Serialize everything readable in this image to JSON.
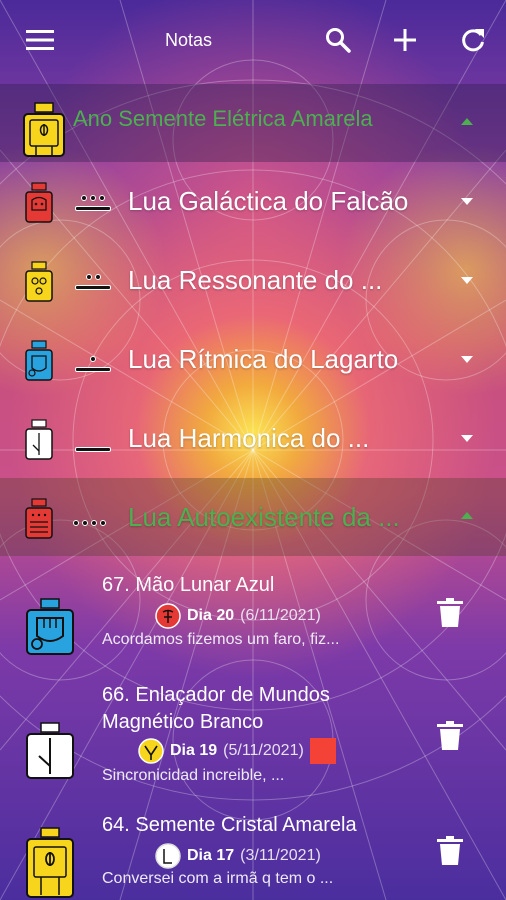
{
  "appbar": {
    "title": "Notas",
    "icons": [
      "menu-icon",
      "search-icon",
      "add-icon",
      "refresh-icon"
    ]
  },
  "year": {
    "label": "Ano Semente Elétrica Amarela",
    "color": "#4caf50",
    "glyph": "seed-yellow-glyph"
  },
  "moons": [
    {
      "label": "Lua Galáctica do Falcão",
      "glyph": "eagle-red-glyph",
      "tone_dots": 3,
      "tone_bars": 1,
      "expanded": false
    },
    {
      "label": "Lua Ressonante do ...",
      "glyph": "sun-yellow-glyph",
      "tone_dots": 2,
      "tone_bars": 1,
      "expanded": false
    },
    {
      "label": "Lua Rítmica do Lagarto",
      "glyph": "hand-blue-glyph",
      "tone_dots": 1,
      "tone_bars": 1,
      "expanded": false
    },
    {
      "label": "Lua Harmonica do ...",
      "glyph": "worldbridger-white-glyph",
      "tone_dots": 0,
      "tone_bars": 1,
      "expanded": false
    },
    {
      "label": "Lua Autoexistente da ...",
      "glyph": "serpent-red-glyph",
      "tone_dots": 4,
      "tone_bars": 0,
      "expanded": true
    }
  ],
  "notes": [
    {
      "title": "67. Mão Lunar Azul",
      "day": "Dia 20",
      "date": "(6/11/2021)",
      "preview": "Acordamos fizemos um faro, fiz...",
      "glyph": "hand-blue-glyph",
      "day_icon": "red-moon-icon"
    },
    {
      "title_line1": "66. Enlaçador de Mundos",
      "title_line2": "Magnético Branco",
      "day": "Dia 19",
      "date": "(5/11/2021)",
      "preview": "Sincronicidad increible, ...",
      "glyph": "worldbridger-white-glyph",
      "day_icon": "yellow-venus-icon",
      "tag_color": "#f44336"
    },
    {
      "title": "64. Semente Cristal Amarela",
      "day": "Dia 17",
      "date": "(3/11/2021)",
      "preview": "Conversei com a irmã q tem o ...",
      "glyph": "seed-yellow-glyph",
      "day_icon": "white-moon-icon"
    }
  ]
}
